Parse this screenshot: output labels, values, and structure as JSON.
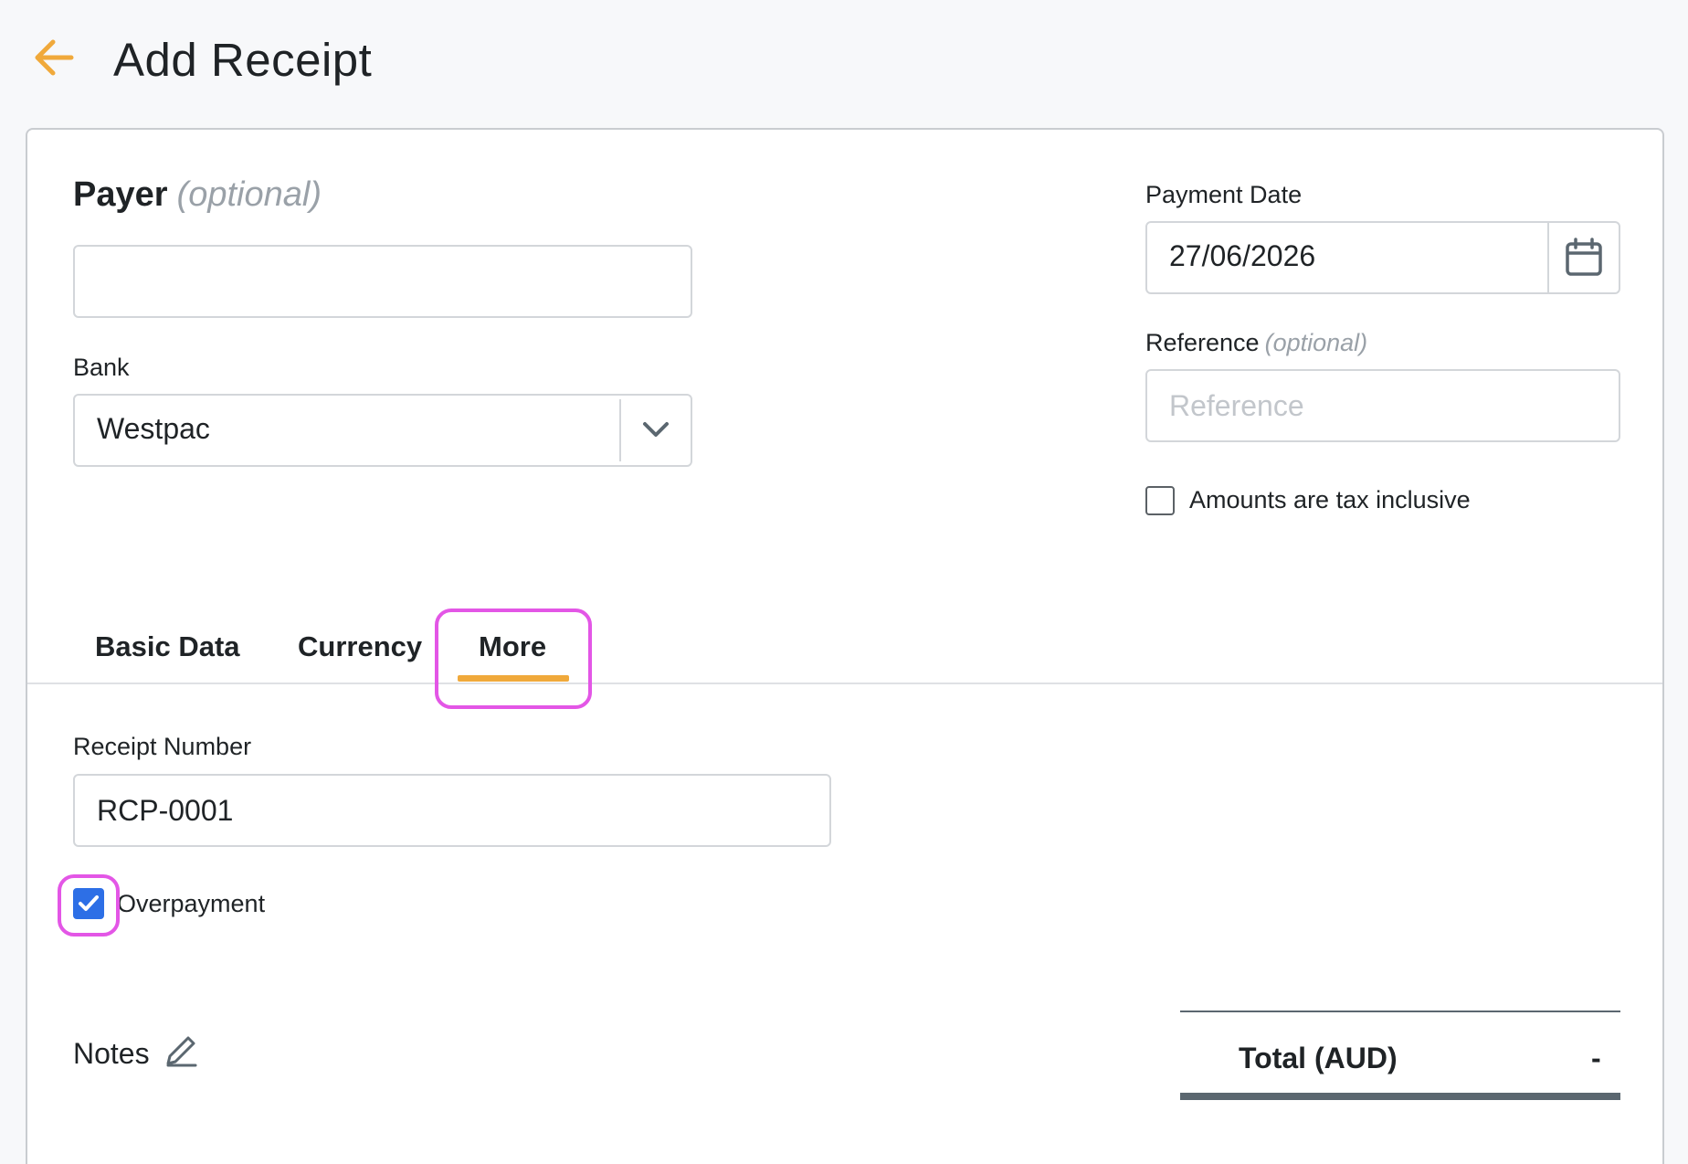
{
  "header": {
    "title": "Add Receipt",
    "back_icon": "arrow-left-icon",
    "accent_color": "#f0a93b"
  },
  "payer": {
    "heading": "Payer",
    "optional": "(optional)",
    "value": ""
  },
  "bank": {
    "label": "Bank",
    "value": "Westpac"
  },
  "payment_date": {
    "label": "Payment Date",
    "value": "27/06/2026",
    "icon": "calendar-icon"
  },
  "reference": {
    "label": "Reference",
    "optional": "(optional)",
    "placeholder": "Reference",
    "value": ""
  },
  "tax_inclusive": {
    "label": "Amounts are tax inclusive",
    "checked": false
  },
  "tabs": [
    {
      "label": "Basic Data",
      "active": false
    },
    {
      "label": "Currency",
      "active": false
    },
    {
      "label": "More",
      "active": true
    }
  ],
  "more": {
    "receipt_number_label": "Receipt Number",
    "receipt_number_value": "RCP-0001",
    "overpayment_label": "Overpayment",
    "overpayment_checked": true
  },
  "notes": {
    "label": "Notes",
    "icon": "pencil-icon"
  },
  "total": {
    "label": "Total (AUD)",
    "value": "-"
  },
  "colors": {
    "highlight": "#e356e6",
    "checkbox_checked": "#2d6fe6"
  }
}
